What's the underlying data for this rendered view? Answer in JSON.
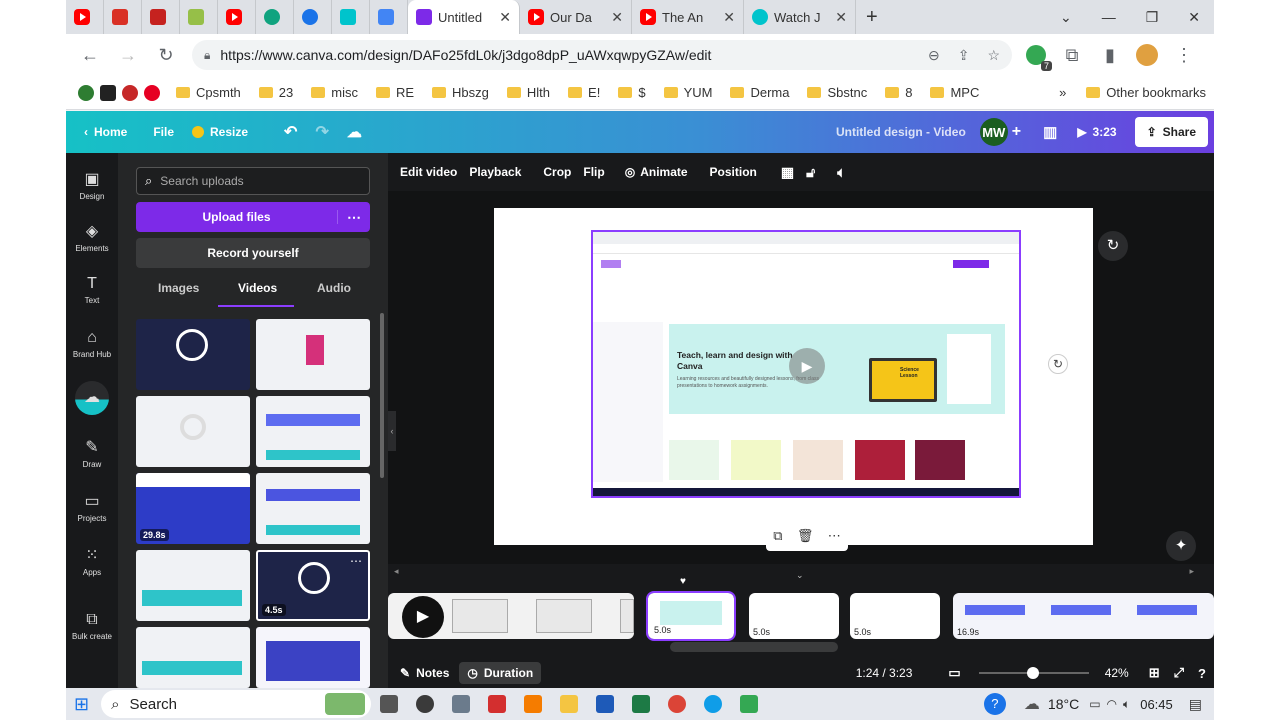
{
  "browser": {
    "tabs": [
      {
        "label": "",
        "icon": "youtube-icon",
        "color": "#ff0000"
      },
      {
        "label": "",
        "icon": "app-icon",
        "color": "#d93025"
      },
      {
        "label": "",
        "icon": "app-icon",
        "color": "#c5221f"
      },
      {
        "label": "",
        "icon": "shopify-icon",
        "color": "#96bf48"
      },
      {
        "label": "",
        "icon": "youtube-icon",
        "color": "#ff0000"
      },
      {
        "label": "",
        "icon": "openai-icon",
        "color": "#10a37f"
      },
      {
        "label": "",
        "icon": "chrome-ext-icon",
        "color": "#1a73e8"
      },
      {
        "label": "",
        "icon": "app-icon",
        "color": "#00c4cc"
      },
      {
        "label": "",
        "icon": "docs-icon",
        "color": "#4285f4"
      },
      {
        "label": "Untitled",
        "icon": "canva-video-icon",
        "color": "#7d2ae8"
      },
      {
        "label": "Our Da",
        "icon": "youtube-icon",
        "color": "#ff0000"
      },
      {
        "label": "The An",
        "icon": "youtube-icon",
        "color": "#ff0000"
      },
      {
        "label": "Watch J",
        "icon": "play-icon",
        "color": "#00c4cc"
      }
    ],
    "new_tab": "+",
    "url": "https://www.canva.com/design/DAFo25fdL0k/j3dgo8dpP_uAWxqwpyGZAw/edit",
    "extension_badge": "7",
    "bookmarks": [
      "Cpsmth",
      "23",
      "misc",
      "RE",
      "Hbszg",
      "Hlth",
      "E!",
      "$",
      "YUM",
      "Derma",
      "Sbstnc",
      "8",
      "MPC"
    ],
    "more": "»",
    "other_bookmarks": "Other bookmarks"
  },
  "canva_header": {
    "home": "Home",
    "file": "File",
    "resize": "Resize",
    "title": "Untitled design - Video",
    "avatar": "MW",
    "play_time": "3:23",
    "share": "Share"
  },
  "rail": [
    "Design",
    "Elements",
    "Text",
    "Brand Hub",
    "",
    "Draw",
    "Projects",
    "Apps",
    "Bulk create"
  ],
  "panel": {
    "search_placeholder": "Search uploads",
    "upload": "Upload files",
    "record": "Record yourself",
    "tabs": [
      "Images",
      "Videos",
      "Audio"
    ],
    "durations": [
      "29.8s",
      "4.5s"
    ]
  },
  "toolbar": [
    "Edit video",
    "Playback",
    "Crop",
    "Flip",
    "Animate",
    "Position"
  ],
  "canvas_video": {
    "headline": "Teach, learn and design with Canva",
    "subline": "Learning resources and beautifully designed lessons, from class presentations to homework assignments.",
    "card_title": "Science Lesson"
  },
  "timeline": {
    "durations": [
      "5.0s",
      "5.0s",
      "5.0s",
      "16.9s"
    ]
  },
  "bottombar": {
    "notes": "Notes",
    "duration": "Duration",
    "time": "1:24 / 3:23",
    "zoom": "42%",
    "zoom_level": 0.5
  },
  "taskbar": {
    "search": "Search",
    "temperature": "18°C",
    "clock": "06:45"
  }
}
